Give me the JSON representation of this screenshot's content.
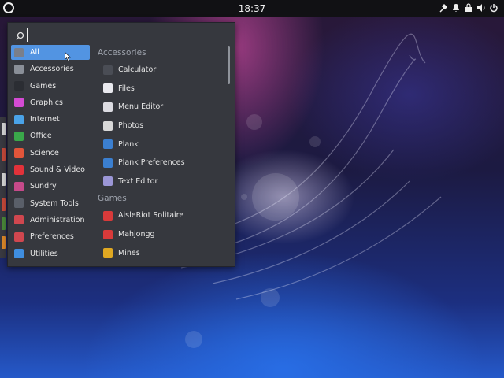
{
  "panel": {
    "clock": "18:37",
    "tray_icons": [
      "tools-icon",
      "notification-bell-icon",
      "lock-icon",
      "volume-icon",
      "power-icon"
    ]
  },
  "menu": {
    "search": {
      "value": "",
      "placeholder": ""
    },
    "categories": [
      {
        "label": "All",
        "icon": "all-icon",
        "color": "#7a7f8a",
        "selected": true
      },
      {
        "label": "Accessories",
        "icon": "accessories-icon",
        "color": "#8a8f98"
      },
      {
        "label": "Games",
        "icon": "games-icon",
        "color": "#2b2d33"
      },
      {
        "label": "Graphics",
        "icon": "graphics-icon",
        "color": "#d44bd4"
      },
      {
        "label": "Internet",
        "icon": "internet-icon",
        "color": "#4aa3e8"
      },
      {
        "label": "Office",
        "icon": "office-icon",
        "color": "#3aa84a"
      },
      {
        "label": "Science",
        "icon": "science-icon",
        "color": "#e2553a"
      },
      {
        "label": "Sound & Video",
        "icon": "sound-video-icon",
        "color": "#e2323a"
      },
      {
        "label": "Sundry",
        "icon": "sundry-icon",
        "color": "#c64a8a"
      },
      {
        "label": "System Tools",
        "icon": "system-tools-icon",
        "color": "#5a5f69"
      },
      {
        "label": "Administration",
        "icon": "administration-icon",
        "color": "#d0474f"
      },
      {
        "label": "Preferences",
        "icon": "preferences-icon",
        "color": "#d0474f"
      },
      {
        "label": "Utilities",
        "icon": "utilities-icon",
        "color": "#3f8ee0"
      }
    ],
    "sections": [
      {
        "title": "Accessories",
        "apps": [
          {
            "label": "Calculator",
            "icon": "calculator-icon",
            "color": "#4a4d55"
          },
          {
            "label": "Files",
            "icon": "files-icon",
            "color": "#e9e9ee"
          },
          {
            "label": "Menu Editor",
            "icon": "menu-editor-icon",
            "color": "#dcdce2"
          },
          {
            "label": "Photos",
            "icon": "photos-icon",
            "color": "#d8d8d8"
          },
          {
            "label": "Plank",
            "icon": "plank-icon",
            "color": "#3b7fd0"
          },
          {
            "label": "Plank Preferences",
            "icon": "plank-preferences-icon",
            "color": "#3b7fd0"
          },
          {
            "label": "Text Editor",
            "icon": "text-editor-icon",
            "color": "#9b96d6"
          }
        ]
      },
      {
        "title": "Games",
        "apps": [
          {
            "label": "AisleRiot Solitaire",
            "icon": "aisleriot-solitaire-icon",
            "color": "#d83a3a"
          },
          {
            "label": "Mahjongg",
            "icon": "mahjongg-icon",
            "color": "#d83a3a"
          },
          {
            "label": "Mines",
            "icon": "mines-icon",
            "color": "#e0a822"
          }
        ]
      }
    ]
  },
  "dock": {
    "items": [
      {
        "icon": "dock-app-icon-1",
        "color": "#d9d9d9"
      },
      {
        "icon": "dock-app-icon-2",
        "color": "#c94a3a"
      },
      {
        "icon": "dock-app-icon-3",
        "color": "#d9d9d9"
      },
      {
        "icon": "dock-app-icon-4",
        "color": "#c94a3a"
      },
      {
        "icon": "dock-app-icon-5",
        "color": "#4b8a3a"
      },
      {
        "icon": "dock-app-icon-6",
        "color": "#e08a2a"
      }
    ]
  }
}
